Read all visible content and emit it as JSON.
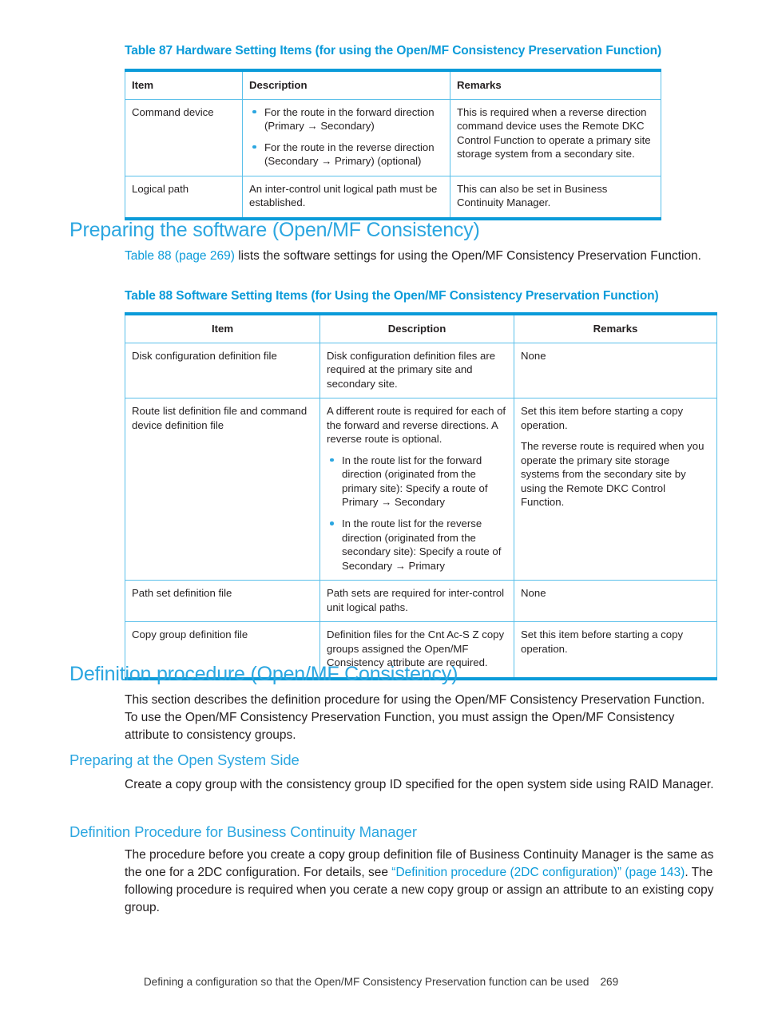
{
  "document": {
    "page_number": "269",
    "footer_text": "Defining a configuration so that the Open/MF Consistency Preservation function can be used"
  },
  "table87": {
    "caption": "Table 87 Hardware Setting Items (for using the Open/MF Consistency Preservation Function)",
    "columns": [
      "Item",
      "Description",
      "Remarks"
    ],
    "rows": [
      {
        "item": "Command device",
        "description_bullets": [
          "For the route in the forward direction (Primary → Secondary)",
          "For the route in the reverse direction (Secondary → Primary) (optional)"
        ],
        "remarks": "This is required when a reverse direction command device uses the Remote DKC Control Function to operate a primary site storage system from a secondary site."
      },
      {
        "item": "Logical path",
        "description": "An inter-control unit logical path must be established.",
        "remarks": "This can also be set in Business Continuity Manager."
      }
    ]
  },
  "section_prep_software": {
    "heading": "Preparing the software (Open/MF Consistency)",
    "intro_link": "Table 88 (page 269)",
    "intro_rest": " lists the software settings for using the Open/MF Consistency Preservation Function."
  },
  "table88": {
    "caption": "Table 88 Software Setting Items (for Using the Open/MF Consistency Preservation Function)",
    "columns": [
      "Item",
      "Description",
      "Remarks"
    ],
    "rows": [
      {
        "item": "Disk configuration definition file",
        "description": "Disk configuration definition files are required at the primary site and secondary site.",
        "remarks": "None"
      },
      {
        "item": "Route list definition file and command device definition file",
        "description_lead": "A different route is required for each of the forward and reverse directions. A reverse route is optional.",
        "description_bullets": [
          "In the route list for the forward direction (originated from the primary site): Specify a route of Primary → Secondary",
          "In the route list for the reverse direction (originated from the secondary site): Specify a route of Secondary → Primary"
        ],
        "remarks_p1": "Set this item before starting a copy operation.",
        "remarks_p2": "The reverse route is required when you operate the primary site storage systems from the secondary site by using the Remote DKC Control Function."
      },
      {
        "item": "Path set definition file",
        "description": "Path sets are required for inter-control unit logical paths.",
        "remarks": "None"
      },
      {
        "item": "Copy group definition file",
        "description": "Definition files for the Cnt Ac-S Z copy groups assigned the Open/MF Consistency attribute are required.",
        "remarks": "Set this item before starting a copy operation."
      }
    ]
  },
  "section_def_procedure": {
    "heading": "Definition procedure (Open/MF Consistency)",
    "paragraph": "This section describes the definition procedure for using the Open/MF Consistency Preservation Function. To use the Open/MF Consistency Preservation Function, you must assign the Open/MF Consistency attribute to consistency groups."
  },
  "section_prep_open_system": {
    "heading": "Preparing at the Open System Side",
    "paragraph": "Create a copy group with the consistency group ID specified for the open system side using RAID Manager."
  },
  "section_def_bcm": {
    "heading": "Definition Procedure for Business Continuity Manager",
    "para_part1": "The procedure before you create a copy group definition file of Business Continuity Manager is the same as the one for a 2DC configuration. For details, see ",
    "para_link": "“Definition procedure (2DC configuration)” (page 143)",
    "para_part2": ". The following procedure is required when you cerate a new copy group or assign an attribute to an existing copy group."
  },
  "colors": {
    "heading_blue": "#2ba6e0",
    "caption_blue": "#0b9bd9",
    "table_rule": "#0b9bd9",
    "table_border": "#5bc0ea",
    "body_text": "#231f20"
  }
}
